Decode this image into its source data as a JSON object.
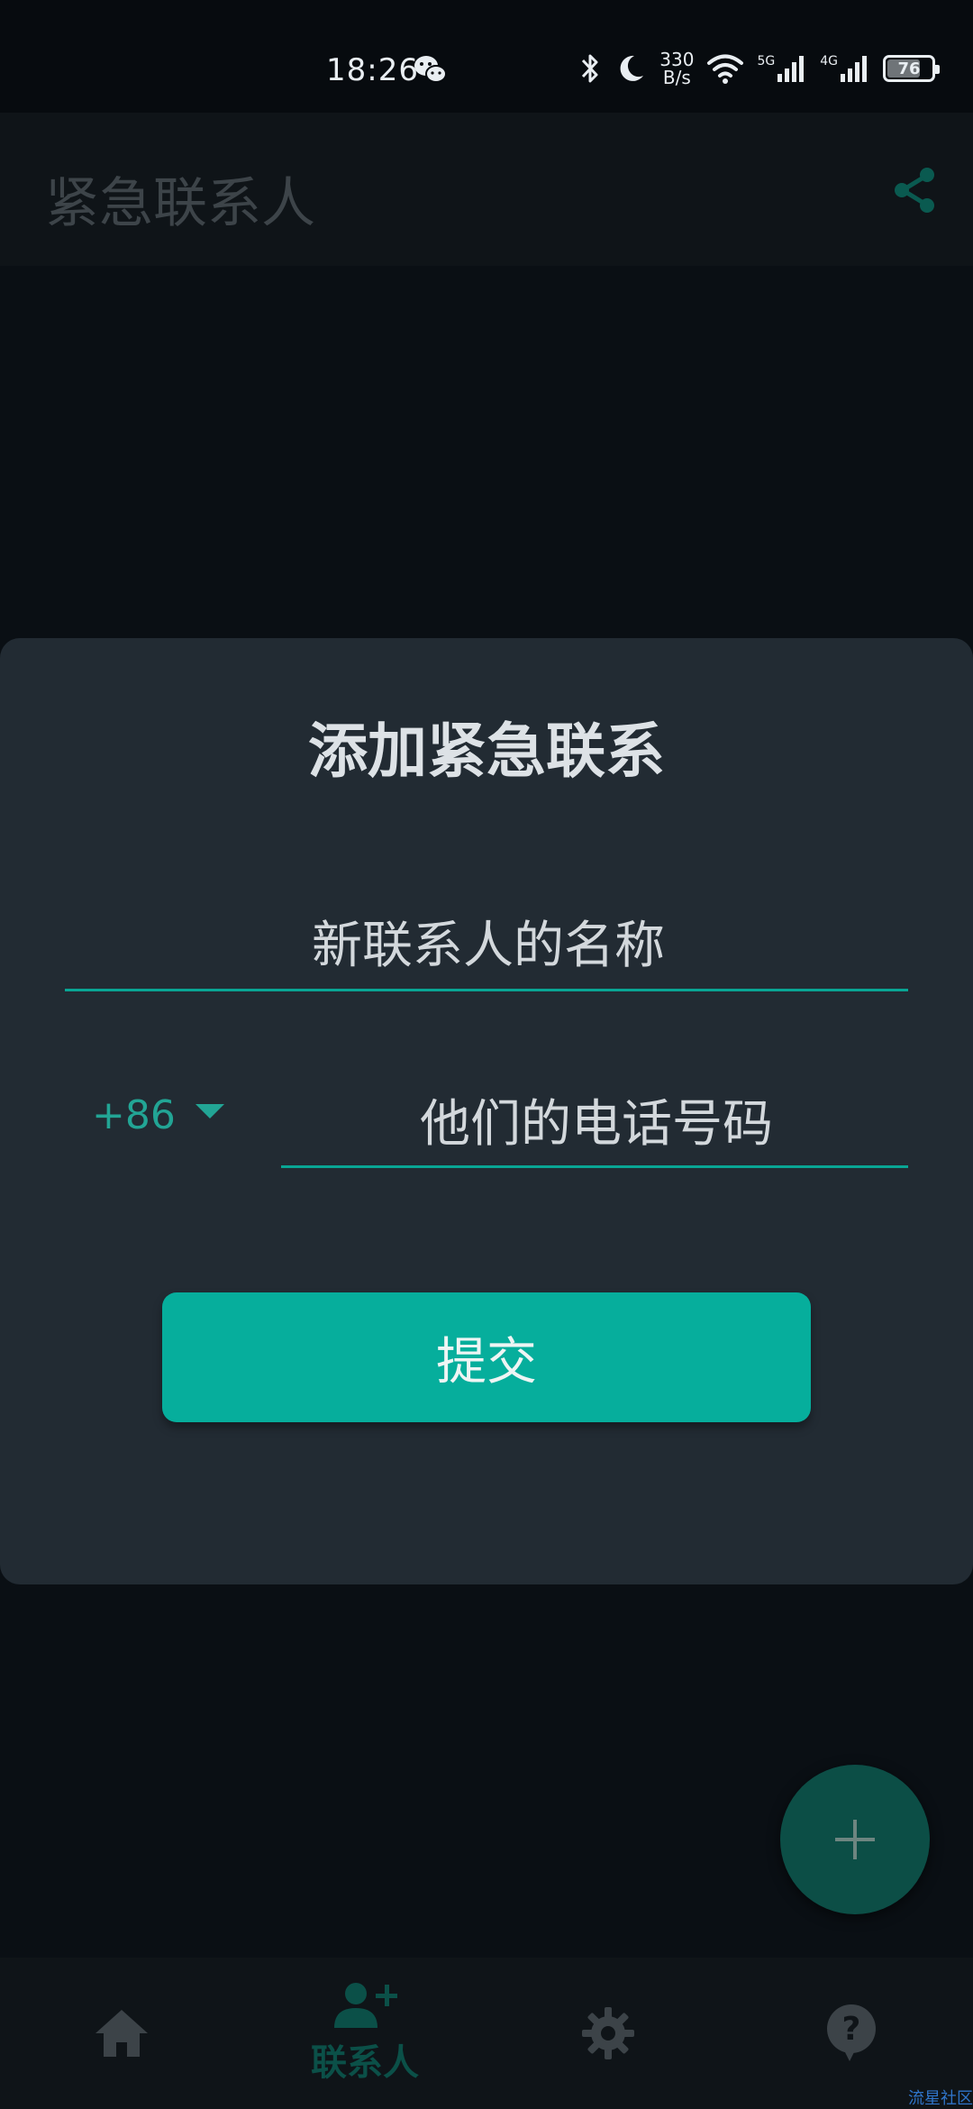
{
  "status_bar": {
    "time": "18:26",
    "net_speed_value": "330",
    "net_speed_unit": "B/s",
    "net_5g": "5G",
    "net_4g": "4G",
    "battery": "76"
  },
  "app_bar": {
    "title": "紧急联系人"
  },
  "dialog": {
    "title": "添加紧急联系",
    "name_placeholder": "新联系人的名称",
    "country_code": "+86",
    "phone_placeholder": "他们的电话号码",
    "submit_label": "提交"
  },
  "bottom_nav": {
    "contacts_label": "联系人",
    "active": "contacts"
  },
  "colors": {
    "accent": "#06ae9c",
    "dialog_bg": "#222b33",
    "fab_bg": "#0c4e46"
  },
  "icons": [
    "wechat-icon",
    "bluetooth-icon",
    "moon-icon",
    "wifi-icon",
    "signal-icon",
    "battery-icon",
    "share-icon",
    "plus-icon",
    "home-icon",
    "add-person-icon",
    "gear-icon",
    "help-icon"
  ],
  "watermark": "流星社区"
}
